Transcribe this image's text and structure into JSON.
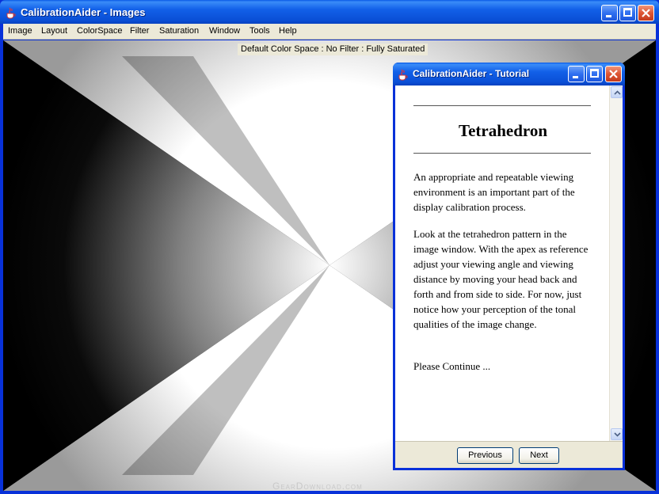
{
  "main_window": {
    "title": "CalibrationAider - Images",
    "menu": [
      "Image",
      "Layout",
      "ColorSpace",
      "Filter",
      "Saturation",
      "Window",
      "Tools",
      "Help"
    ],
    "status": "Default Color Space : No Filter : Fully Saturated"
  },
  "tutorial": {
    "title": "CalibrationAider - Tutorial",
    "heading": "Tetrahedron",
    "paragraphs": [
      "An appropriate and repeatable viewing environment is an important part of the display calibration process.",
      "Look at the tetrahedron pattern in the image window. With the apex as reference adjust your viewing angle and viewing distance by moving your head back and forth and from side to side. For now, just notice how your perception of the tonal qualities of the image change.",
      "Please Continue ..."
    ],
    "previous_label": "Previous",
    "next_label": "Next"
  },
  "watermark": "GearDownload.com",
  "icons": {
    "app": "java-cup-icon",
    "minimize": "minimize-icon",
    "maximize": "maximize-icon",
    "close": "close-icon",
    "scroll_up": "arrow-up-icon",
    "scroll_down": "arrow-down-icon"
  },
  "colors": {
    "titlebar_blue": "#0a4fd6",
    "close_red": "#dd5533",
    "chrome_beige": "#ece9d8"
  }
}
